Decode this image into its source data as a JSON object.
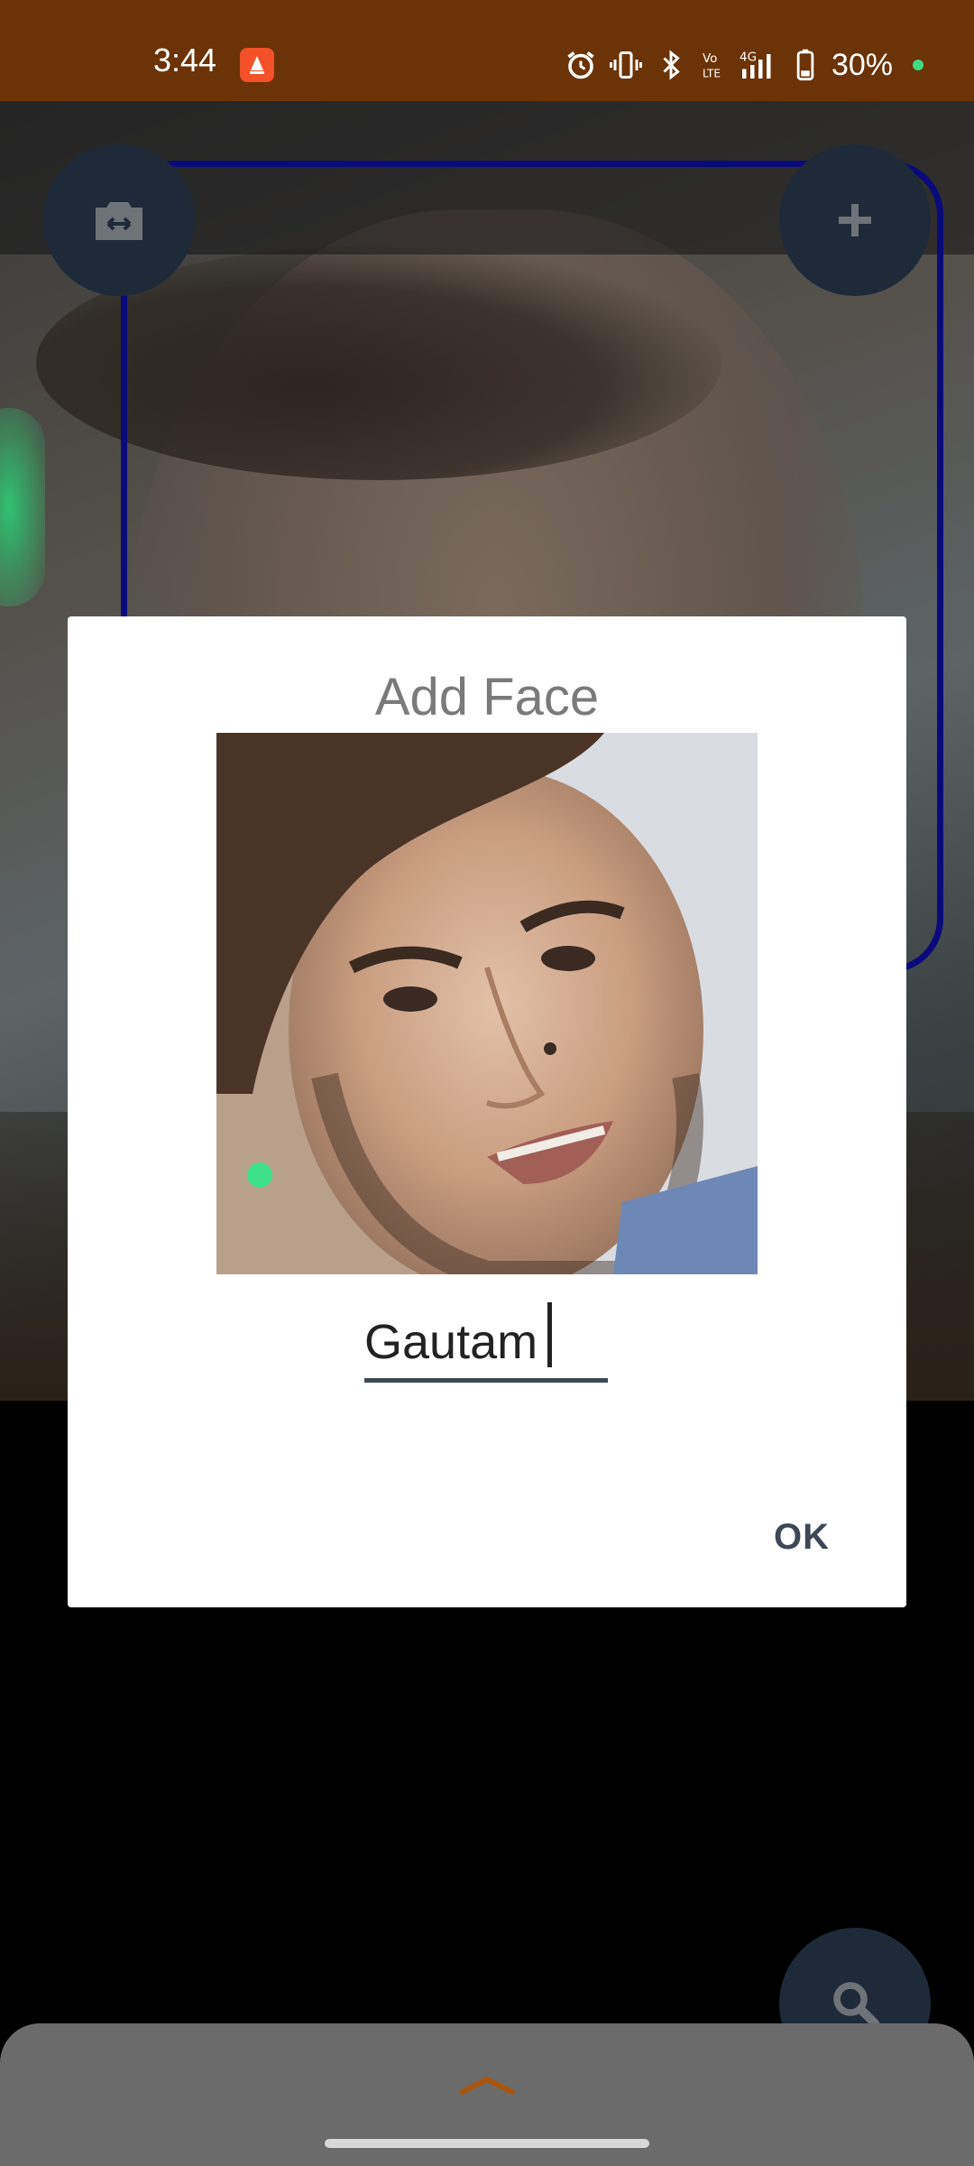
{
  "status_bar": {
    "time": "3:44",
    "battery": "30%",
    "network": "4G",
    "icons": [
      "app-notification-icon",
      "alarm-icon",
      "vibrate-icon",
      "bluetooth-icon",
      "volte-icon",
      "signal-icon",
      "battery-icon"
    ]
  },
  "camera": {
    "switch_camera_icon": "camera-switch-icon",
    "add_icon": "plus-icon",
    "face_box_color": "#0a0a7a"
  },
  "dialog": {
    "title": "Add Face",
    "name_value": "Gautam",
    "ok_label": "OK"
  },
  "search_fab": {
    "icon": "search-icon"
  },
  "bottom_sheet": {
    "icon": "chevron-up-icon"
  },
  "colors": {
    "status_bar": "#6b3306",
    "fab": "#1f2a38",
    "accent_text": "#3d4756",
    "chevron": "#a8560f"
  }
}
